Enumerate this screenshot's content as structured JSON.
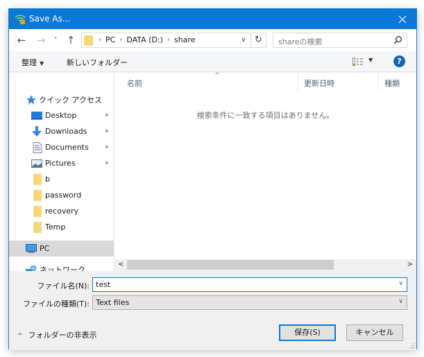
{
  "window": {
    "title": "Save As...",
    "close_label": "✕"
  },
  "nav": {
    "back": "←",
    "forward": "→",
    "recent": "˅",
    "up": "↑",
    "breadcrumbs": [
      "PC",
      "DATA (D:)",
      "share"
    ],
    "separator": "›",
    "address_dropdown": "∨",
    "refresh": "↻",
    "search_placeholder": "shareの検索"
  },
  "toolbar": {
    "organize": "整理",
    "new_folder": "新しいフォルダー",
    "caret": "▼",
    "help": "?"
  },
  "sidebar": {
    "quick_access": "クイック アクセス",
    "items": [
      {
        "label": "Desktop",
        "icon": "desktop-icon",
        "pinned": true
      },
      {
        "label": "Downloads",
        "icon": "download-icon",
        "pinned": true
      },
      {
        "label": "Documents",
        "icon": "document-icon",
        "pinned": true
      },
      {
        "label": "Pictures",
        "icon": "picture-icon",
        "pinned": true
      },
      {
        "label": "b",
        "icon": "folder-icon",
        "pinned": false
      },
      {
        "label": "password",
        "icon": "folder-icon",
        "pinned": false
      },
      {
        "label": "recovery",
        "icon": "folder-icon",
        "pinned": false
      },
      {
        "label": "Temp",
        "icon": "folder-icon",
        "pinned": false
      }
    ],
    "pc": "PC",
    "network": "ネットワーク",
    "pin_glyph": "📌"
  },
  "content": {
    "columns": [
      "名前",
      "更新日時",
      "種類"
    ],
    "sort_indicator": "^",
    "empty_message": "検索条件に一致する項目はありません。",
    "scroll_left": "<",
    "scroll_right": ">"
  },
  "fields": {
    "filename_label": "ファイル名(N):",
    "filename_value": "test",
    "filetype_label": "ファイルの種類(T):",
    "filetype_value": "Text files",
    "dropdown_glyph": "∨"
  },
  "footer": {
    "hide_folders": "フォルダーの非表示",
    "hide_chevron": "^",
    "save": "保存(S)",
    "cancel": "キャンセル"
  },
  "colors": {
    "titlebar": "#0a78d7",
    "accent": "#0a78d7",
    "folder": "#f8d775",
    "help": "#1565c0"
  }
}
